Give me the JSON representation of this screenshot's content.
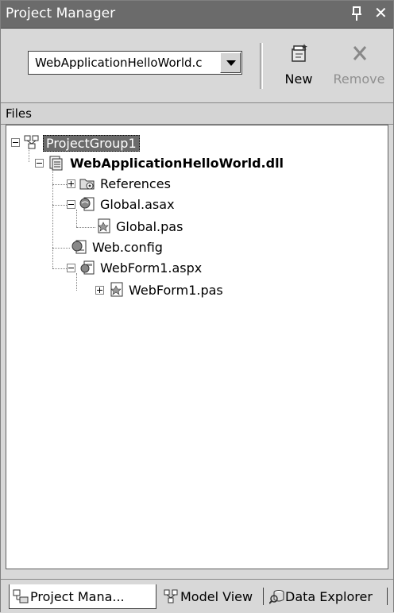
{
  "window": {
    "title": "Project Manager",
    "pin_icon": "pin-icon",
    "close_icon": "close-icon"
  },
  "toolbar": {
    "project_combo_value": "WebApplicationHelloWorld.c",
    "new_label": "New",
    "remove_label": "Remove"
  },
  "files_header": "Files",
  "tree": {
    "project_group": "ProjectGroup1",
    "assembly": "WebApplicationHelloWorld.dll",
    "references": "References",
    "global_asax": "Global.asax",
    "global_pas": "Global.pas",
    "web_config": "Web.config",
    "webform_aspx": "WebForm1.aspx",
    "webform_pas": "WebForm1.pas"
  },
  "tabs": [
    {
      "label": "Project Mana...",
      "icon": "project-manager-icon",
      "active": true
    },
    {
      "label": "Model View",
      "icon": "model-view-icon",
      "active": false
    },
    {
      "label": "Data Explorer",
      "icon": "data-explorer-icon",
      "active": false
    }
  ],
  "colors": {
    "title_bar": "#6b6b6b",
    "panel": "#d8d8d8",
    "selection": "#6b6b6b"
  }
}
